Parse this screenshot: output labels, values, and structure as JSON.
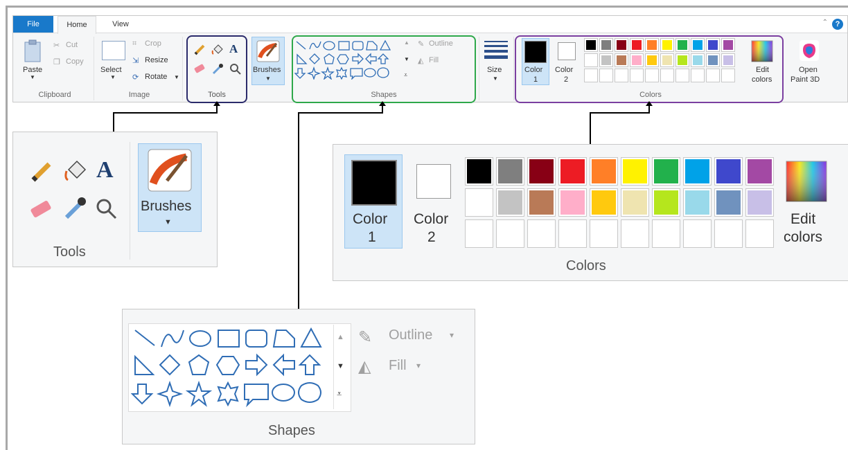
{
  "ribbon": {
    "tabs": [
      "File",
      "Home",
      "View"
    ],
    "help": "?",
    "clipboard": {
      "paste": "Paste",
      "cut": "Cut",
      "copy": "Copy",
      "label": "Clipboard"
    },
    "image": {
      "select": "Select",
      "crop": "Crop",
      "resize": "Resize",
      "rotate": "Rotate",
      "label": "Image"
    },
    "tools": {
      "label": "Tools"
    },
    "brushes": {
      "label": "Brushes"
    },
    "shapes": {
      "outline": "Outline",
      "fill": "Fill",
      "label": "Shapes"
    },
    "size": {
      "label": "Size"
    },
    "colors": {
      "color1": "Color",
      "color1_num": "1",
      "color2": "Color",
      "color2_num": "2",
      "edit": "Edit",
      "edit2": "colors",
      "label": "Colors"
    },
    "paint3d": {
      "line1": "Open",
      "line2": "Paint 3D"
    }
  },
  "zoom_tools": {
    "brushes": "Brushes",
    "label": "Tools"
  },
  "zoom_colors": {
    "color1": "Color",
    "color1_num": "1",
    "color2": "Color",
    "color2_num": "2",
    "edit": "Edit",
    "edit2": "colors",
    "label": "Colors"
  },
  "zoom_shapes": {
    "outline": "Outline",
    "fill": "Fill",
    "label": "Shapes"
  },
  "palette": {
    "row1": [
      "#000000",
      "#7f7f7f",
      "#880015",
      "#ed1c24",
      "#ff7f27",
      "#fff200",
      "#22b14c",
      "#00a2e8",
      "#3f48cc",
      "#a349a4"
    ],
    "row2": [
      "#ffffff",
      "#c3c3c3",
      "#b97a57",
      "#ffaec9",
      "#ffc90e",
      "#efe4b0",
      "#b5e61d",
      "#99d9ea",
      "#7092be",
      "#c8bfe7"
    ]
  },
  "accents": {
    "tools_box": "#2b2b6b",
    "shapes_box": "#2ea84a",
    "colors_box": "#7b3fa0",
    "file_tab": "#1979ca"
  }
}
